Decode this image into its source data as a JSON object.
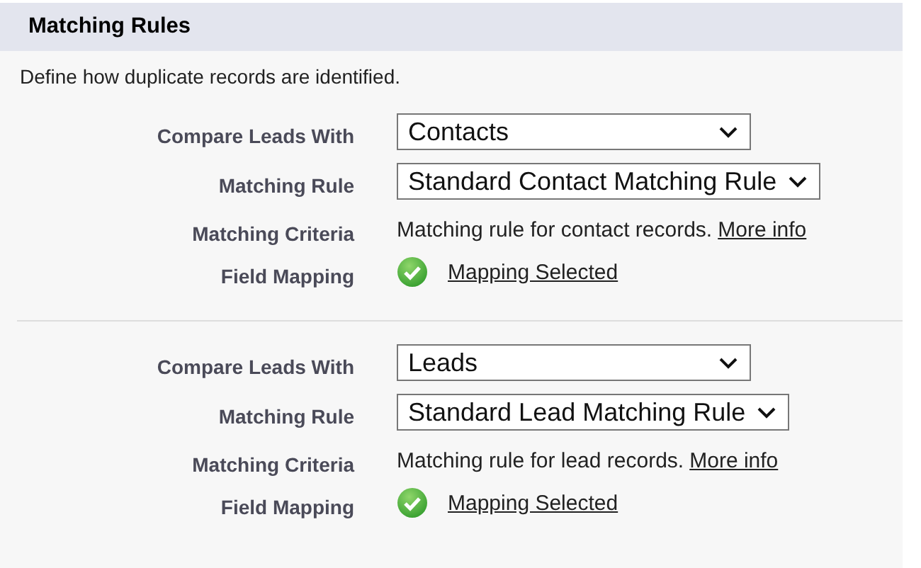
{
  "section": {
    "title": "Matching Rules",
    "description": "Define how duplicate records are identified."
  },
  "rule_groups": [
    {
      "compare_label": "Compare Leads With",
      "compare_value": "Contacts",
      "rule_label": "Matching Rule",
      "rule_value": "Standard Contact Matching Rule",
      "criteria_label": "Matching Criteria",
      "criteria_text": "Matching rule for contact records.",
      "criteria_link": "More info",
      "mapping_label": "Field Mapping",
      "mapping_link": "Mapping Selected"
    },
    {
      "compare_label": "Compare Leads With",
      "compare_value": "Leads",
      "rule_label": "Matching Rule",
      "rule_value": "Standard Lead Matching Rule",
      "criteria_label": "Matching Criteria",
      "criteria_text": "Matching rule for lead records.",
      "criteria_link": "More info",
      "mapping_label": "Field Mapping",
      "mapping_link": "Mapping Selected"
    }
  ]
}
